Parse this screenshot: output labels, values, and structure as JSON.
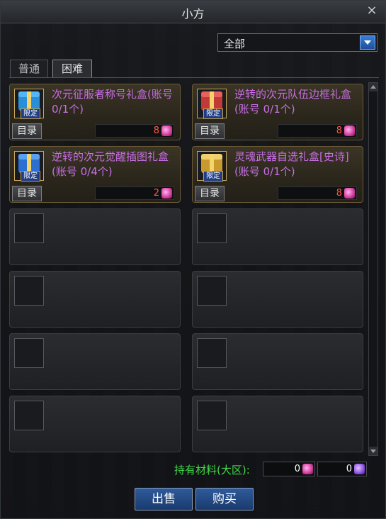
{
  "window": {
    "title": "小方",
    "close_glyph": "×"
  },
  "filter": {
    "selected": "全部"
  },
  "tabs": [
    {
      "label": "普通",
      "active": false
    },
    {
      "label": "困难",
      "active": true
    }
  ],
  "items": [
    {
      "name": "次元征服者称号礼盒(账号 0/1个)",
      "badge": "限定",
      "catalog_label": "目录",
      "price": "8",
      "currency_icon": "pink-gem-icon",
      "gift_color": "#2a8fd8",
      "lid_color": "#55b6f5"
    },
    {
      "name": "逆转的次元队伍边框礼盒(账号 0/1个)",
      "badge": "限定",
      "catalog_label": "目录",
      "price": "8",
      "currency_icon": "pink-gem-icon",
      "gift_color": "#c23a38",
      "lid_color": "#e8615c"
    },
    {
      "name": "逆转的次元觉醒插图礼盒(账号 0/4个)",
      "badge": "限定",
      "catalog_label": "目录",
      "price": "2",
      "currency_icon": "pink-gem-icon",
      "gift_color": "#2b6fd0",
      "lid_color": "#5aa0ef"
    },
    {
      "name": "灵魂武器自选礼盒[史诗](账号 0/1个)",
      "badge": "限定",
      "catalog_label": "目录",
      "price": "8",
      "currency_icon": "pink-gem-icon",
      "gift_color": "#c89a2e",
      "lid_color": "#f0cf6a"
    }
  ],
  "materials": {
    "label": "持有材料(大区):",
    "pink_count": "0",
    "violet_count": "0"
  },
  "buttons": {
    "sell": "出售",
    "buy": "购买"
  },
  "colors": {
    "accent_blue": "#2f5a9a",
    "item_name": "#c86ee6",
    "price": "#ff5a44",
    "materials_label": "#42d84a"
  }
}
